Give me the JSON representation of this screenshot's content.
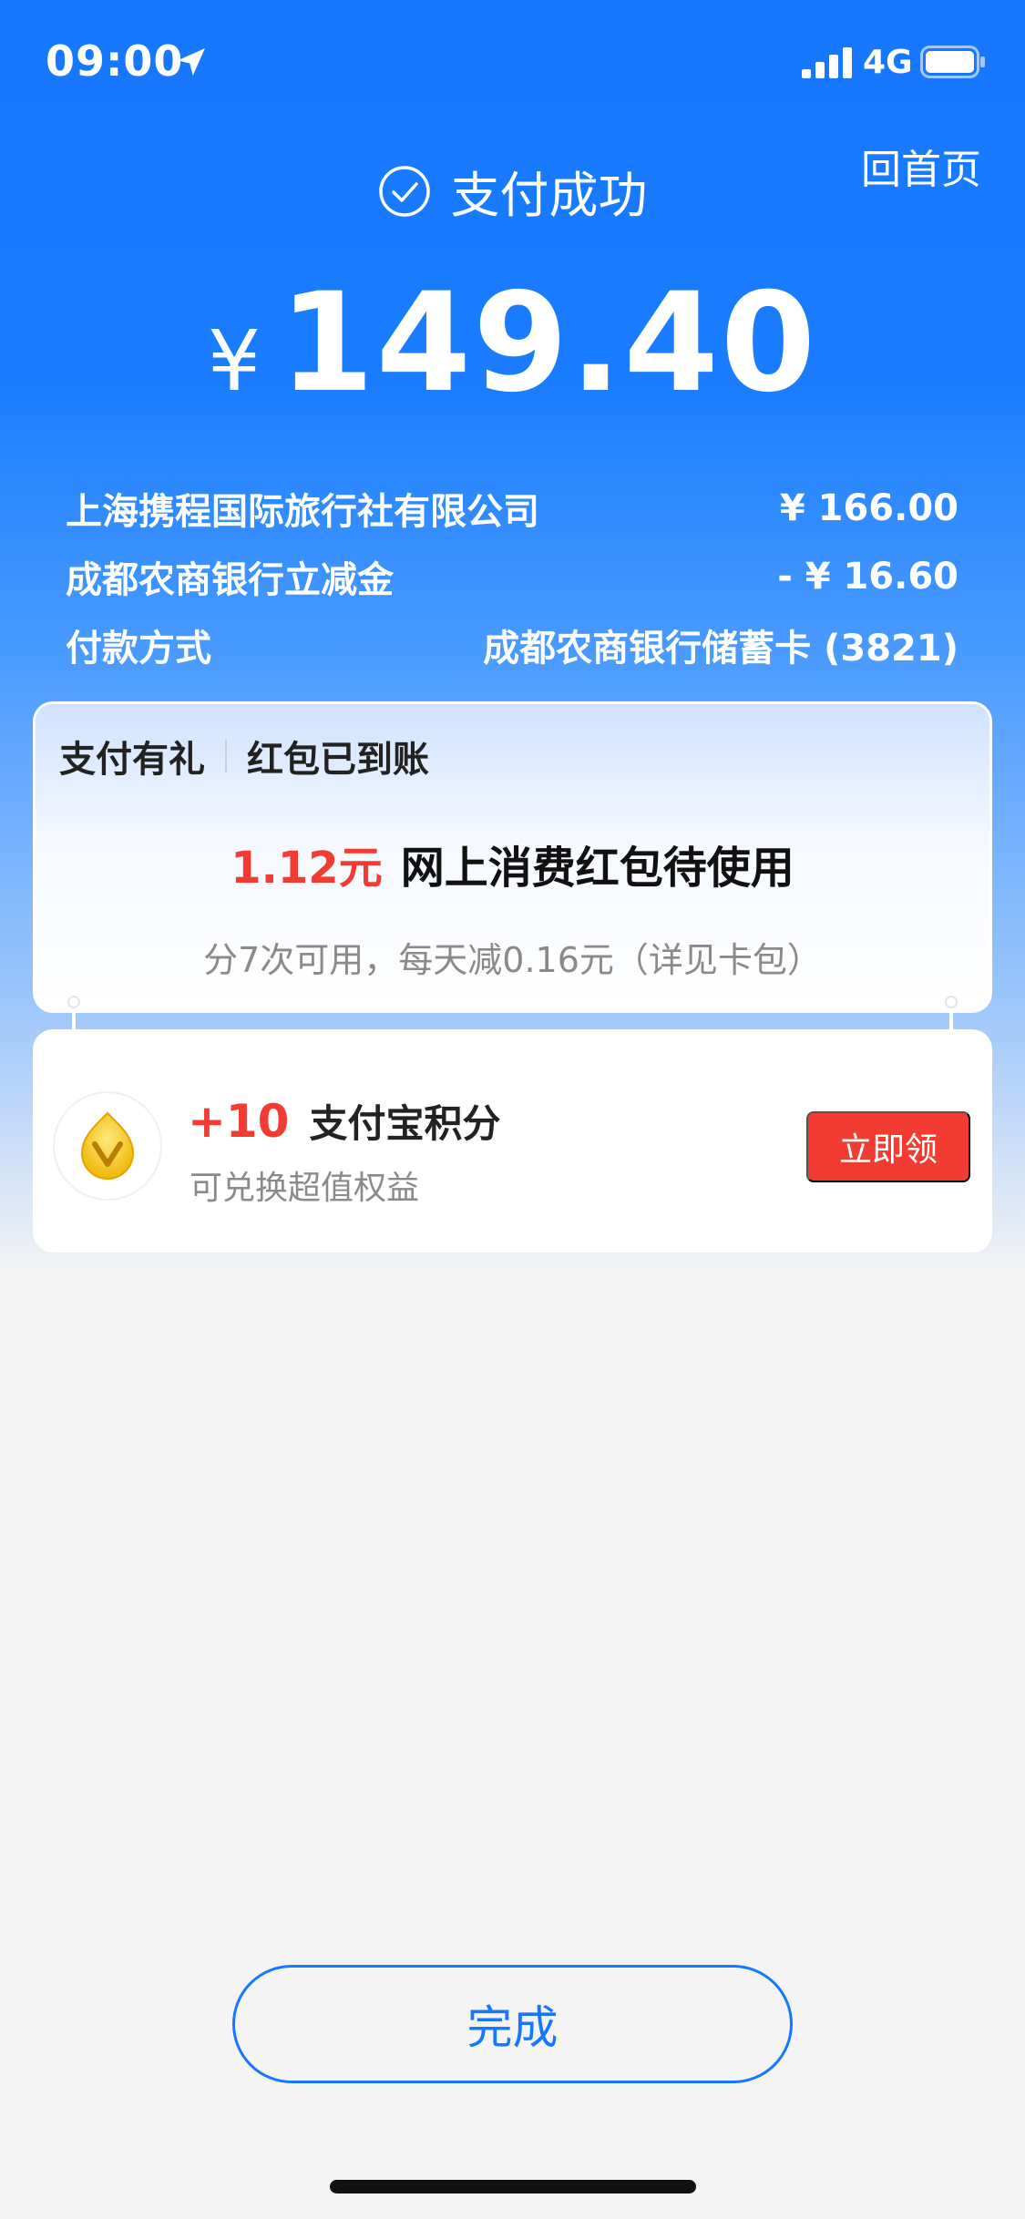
{
  "status_bar": {
    "time": "09:00",
    "network": "4G",
    "icons": [
      "location-arrow-icon",
      "signal-bars-icon",
      "battery-icon"
    ]
  },
  "header": {
    "home_link": "回首页",
    "title": "支付成功",
    "title_icon": "check-circle-icon",
    "currency_symbol": "¥",
    "amount": "149.40"
  },
  "details": [
    {
      "label": "上海携程国际旅行社有限公司",
      "value": "¥ 166.00"
    },
    {
      "label": "成都农商银行立减金",
      "value": "- ¥ 16.60"
    },
    {
      "label": "付款方式",
      "value": "成都农商银行储蓄卡 (3821)"
    }
  ],
  "reward_card": {
    "tag": "支付有礼",
    "status": "红包已到账",
    "amount": "1.12元",
    "description": "网上消费红包待使用",
    "note": "分7次可用，每天减0.16元（详见卡包）"
  },
  "points_card": {
    "icon": "gold-coin-icon",
    "plus": "+10",
    "title": "支付宝积分",
    "subtitle": "可兑换超值权益",
    "button": "立即领"
  },
  "footer": {
    "done_button": "完成"
  },
  "colors": {
    "brand_blue": "#1677ff",
    "accent_red": "#f23c33",
    "background": "#f4f4f5"
  }
}
